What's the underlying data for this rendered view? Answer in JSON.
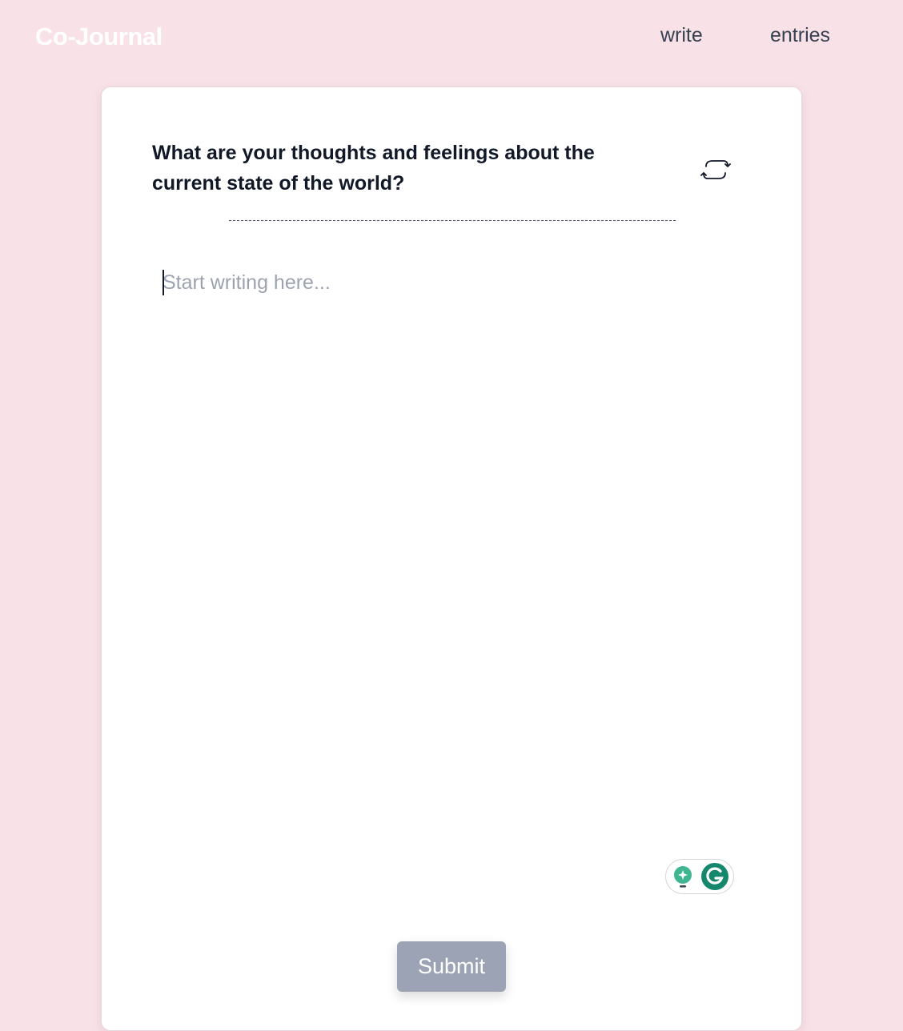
{
  "header": {
    "brand": "Co-Journal",
    "nav": [
      {
        "label": "write"
      },
      {
        "label": "entries"
      }
    ]
  },
  "card": {
    "prompt": "What are your thoughts and feelings about the current state of the world?",
    "refresh_icon": "refresh-cycle-icon",
    "editor": {
      "value": "",
      "placeholder": "Start writing here..."
    },
    "assist_icons": [
      "lightbulb-icon",
      "grammarly-icon"
    ],
    "submit_label": "Submit"
  },
  "colors": {
    "background": "#f8e1e7",
    "card": "#ffffff",
    "submit_button": "#9ca3b4",
    "grammarly": "#15876c",
    "bulb": "#3fb68f"
  }
}
